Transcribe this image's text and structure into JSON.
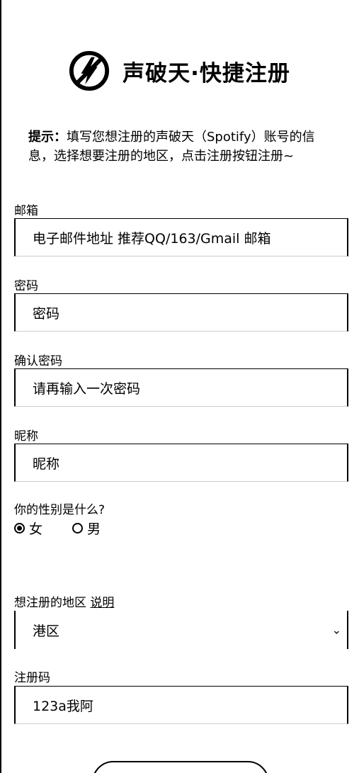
{
  "header": {
    "title": "声破天·快捷注册",
    "logo_icon": "no-lightning-icon"
  },
  "tip": {
    "prefix": "提示：",
    "text": "填写您想注册的声破天（Spotify）账号的信息，选择想要注册的地区，点击注册按钮注册~"
  },
  "form": {
    "email": {
      "label": "邮箱",
      "placeholder": "电子邮件地址 推荐QQ/163/Gmail 邮箱"
    },
    "password": {
      "label": "密码",
      "placeholder": "密码"
    },
    "confirm": {
      "label": "确认密码",
      "placeholder": "请再输入一次密码"
    },
    "nickname": {
      "label": "昵称",
      "placeholder": "昵称"
    },
    "gender": {
      "label": "你的性别是什么?",
      "options": [
        "女",
        "男"
      ],
      "selected": "女"
    },
    "region": {
      "label": "想注册的地区",
      "link": "说明",
      "value": "港区"
    },
    "code": {
      "label": "注册码",
      "value": "123a我阿"
    }
  }
}
